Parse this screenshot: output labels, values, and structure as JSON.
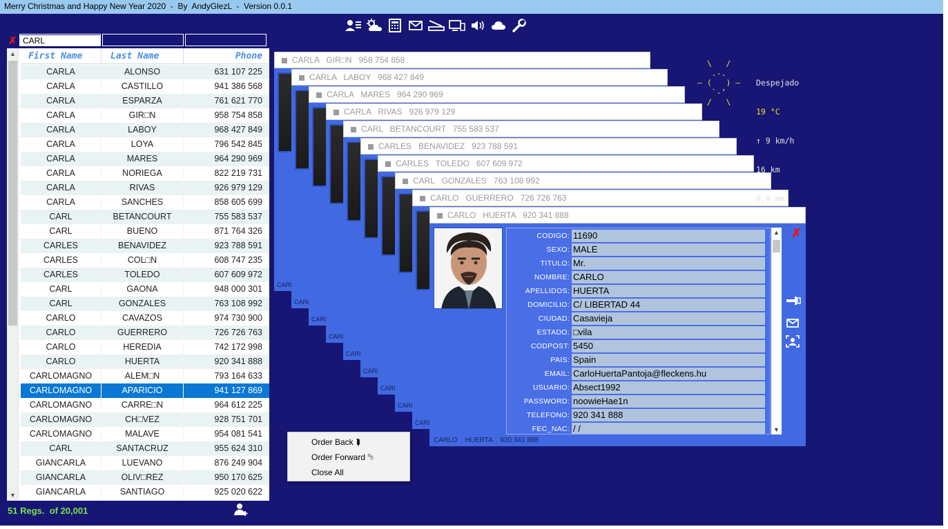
{
  "window": {
    "title": "Merry Christmas and Happy New Year 2020  -  By  AndyGlezL  -  Version 0.0.1"
  },
  "toolbar": {
    "icons": [
      "contacts-icon",
      "weather-icon",
      "calculator-icon",
      "mail-icon",
      "scanner-icon",
      "devices-icon",
      "speaker-icon",
      "cloud-icon",
      "wrench-icon"
    ]
  },
  "filters": {
    "first_name": "CARL",
    "last_name": "",
    "phone": ""
  },
  "grid": {
    "columns": [
      "First Name",
      "Last Name",
      "Phone"
    ],
    "rows": [
      [
        "CARLA",
        "ALONSO",
        "631 107 225"
      ],
      [
        "CARLA",
        "CASTILLO",
        "941 386 568"
      ],
      [
        "CARLA",
        "ESPARZA",
        "761 621 770"
      ],
      [
        "CARLA",
        "GIR□N",
        "958 754 858"
      ],
      [
        "CARLA",
        "LABOY",
        "968 427 849"
      ],
      [
        "CARLA",
        "LOYA",
        "796 542 845"
      ],
      [
        "CARLA",
        "MARES",
        "964 290 969"
      ],
      [
        "CARLA",
        "NORIEGA",
        "822 219 731"
      ],
      [
        "CARLA",
        "RIVAS",
        "926 979 129"
      ],
      [
        "CARLA",
        "SANCHES",
        "858 605 699"
      ],
      [
        "CARL",
        "BETANCOURT",
        "755 583 537"
      ],
      [
        "CARL",
        "BUENO",
        "871 764 326"
      ],
      [
        "CARLES",
        "BENAVIDEZ",
        "923 788 591"
      ],
      [
        "CARLES",
        "COL□N",
        "608 747 235"
      ],
      [
        "CARLES",
        "TOLEDO",
        "607 609 972"
      ],
      [
        "CARL",
        "GAONA",
        "948 000 301"
      ],
      [
        "CARL",
        "GONZALES",
        "763 108 992"
      ],
      [
        "CARLO",
        "CAVAZOS",
        "974 730 900"
      ],
      [
        "CARLO",
        "GUERRERO",
        "726 726 763"
      ],
      [
        "CARLO",
        "HEREDIA",
        "742 172 998"
      ],
      [
        "CARLO",
        "HUERTA",
        "920 341 888"
      ],
      [
        "CARLOMAGNO",
        "ALEM□N",
        "793 164 633"
      ],
      [
        "CARLOMAGNO",
        "APARICIO",
        "941 127 869"
      ],
      [
        "CARLOMAGNO",
        "CARRE□N",
        "964 612 225"
      ],
      [
        "CARLOMAGNO",
        "CH□VEZ",
        "928 751 701"
      ],
      [
        "CARLOMAGNO",
        "MALAVE",
        "954 081 541"
      ],
      [
        "CARL",
        "SANTACRUZ",
        "955 624 310"
      ],
      [
        "GIANCARLA",
        "LUEVANO",
        "876 249 904"
      ],
      [
        "GIANCARLA",
        "OLIV□REZ",
        "950 170 625"
      ],
      [
        "GIANCARLA",
        "SANTIAGO",
        "925 020 622"
      ]
    ],
    "selected_row": 22
  },
  "status": {
    "records": "51 Regs.  of 20,001"
  },
  "cards": [
    {
      "title": "CARLA   GIR□N   958 754 858",
      "footer": "CARL"
    },
    {
      "title": "CARLA   LABOY   968 427 849",
      "footer": "CARL"
    },
    {
      "title": "CARLA   MARES   964 290 969",
      "footer": "CARL"
    },
    {
      "title": "CARLA   RIVAS   926 979 129",
      "footer": "CARL"
    },
    {
      "title": "CARL   BETANCOURT   755 583 537",
      "footer": "CARL"
    },
    {
      "title": "CARLES   BENAVIDEZ   923 788 591",
      "footer": "CARL"
    },
    {
      "title": "CARLES   TOLEDO   607 609 972",
      "footer": "CARL"
    },
    {
      "title": "CARL   GONZALES   763 108 992",
      "footer": "CARL"
    },
    {
      "title": "CARLO   GUERRERO   726 726 763",
      "footer": "CARL"
    }
  ],
  "active_card": {
    "title": "CARLO   HUERTA   920 341 888",
    "footer": "CARLO    HUERTA    920 341 888",
    "fields": [
      {
        "label": "CODIGO:",
        "value": "11690"
      },
      {
        "label": "SEXO:",
        "value": "MALE"
      },
      {
        "label": "TITULO:",
        "value": "Mr."
      },
      {
        "label": "NOMBRE:",
        "value": "CARLO"
      },
      {
        "label": "APELLIDOS:",
        "value": "HUERTA"
      },
      {
        "label": "DOMICILIO:",
        "value": "C/ LIBERTAD 44"
      },
      {
        "label": "CIUDAD:",
        "value": "Casavieja"
      },
      {
        "label": "ESTADO:",
        "value": "□vila"
      },
      {
        "label": "CODPOST:",
        "value": "5450"
      },
      {
        "label": "PAIS:",
        "value": "Spain"
      },
      {
        "label": "EMAIL:",
        "value": "CarloHuertaPantoja@fleckens.hu"
      },
      {
        "label": "USUARIO:",
        "value": "Absect1992"
      },
      {
        "label": "PASSWORD:",
        "value": "noowieHae1n"
      },
      {
        "label": "TELEFONO:",
        "value": "920 341 888"
      },
      {
        "label": "FEC_NAC:",
        "value": " / /"
      }
    ],
    "side_icons": [
      "phone-icon",
      "mail-icon",
      "contact-card-icon"
    ]
  },
  "weather": {
    "condition": "Despejado",
    "temp": "19 °C",
    "wind": "↑ 9 km/h",
    "visibility": "16 km",
    "rain": "0.0 mm",
    "sun_art": [
      "  \\   /  ",
      "   .-.   ",
      "― (   ) ―",
      "   `-’   ",
      "  /   \\  "
    ]
  },
  "context_menu": {
    "items": [
      "Order Back ⮯",
      "Order Forward ⮷",
      "Close All"
    ]
  }
}
